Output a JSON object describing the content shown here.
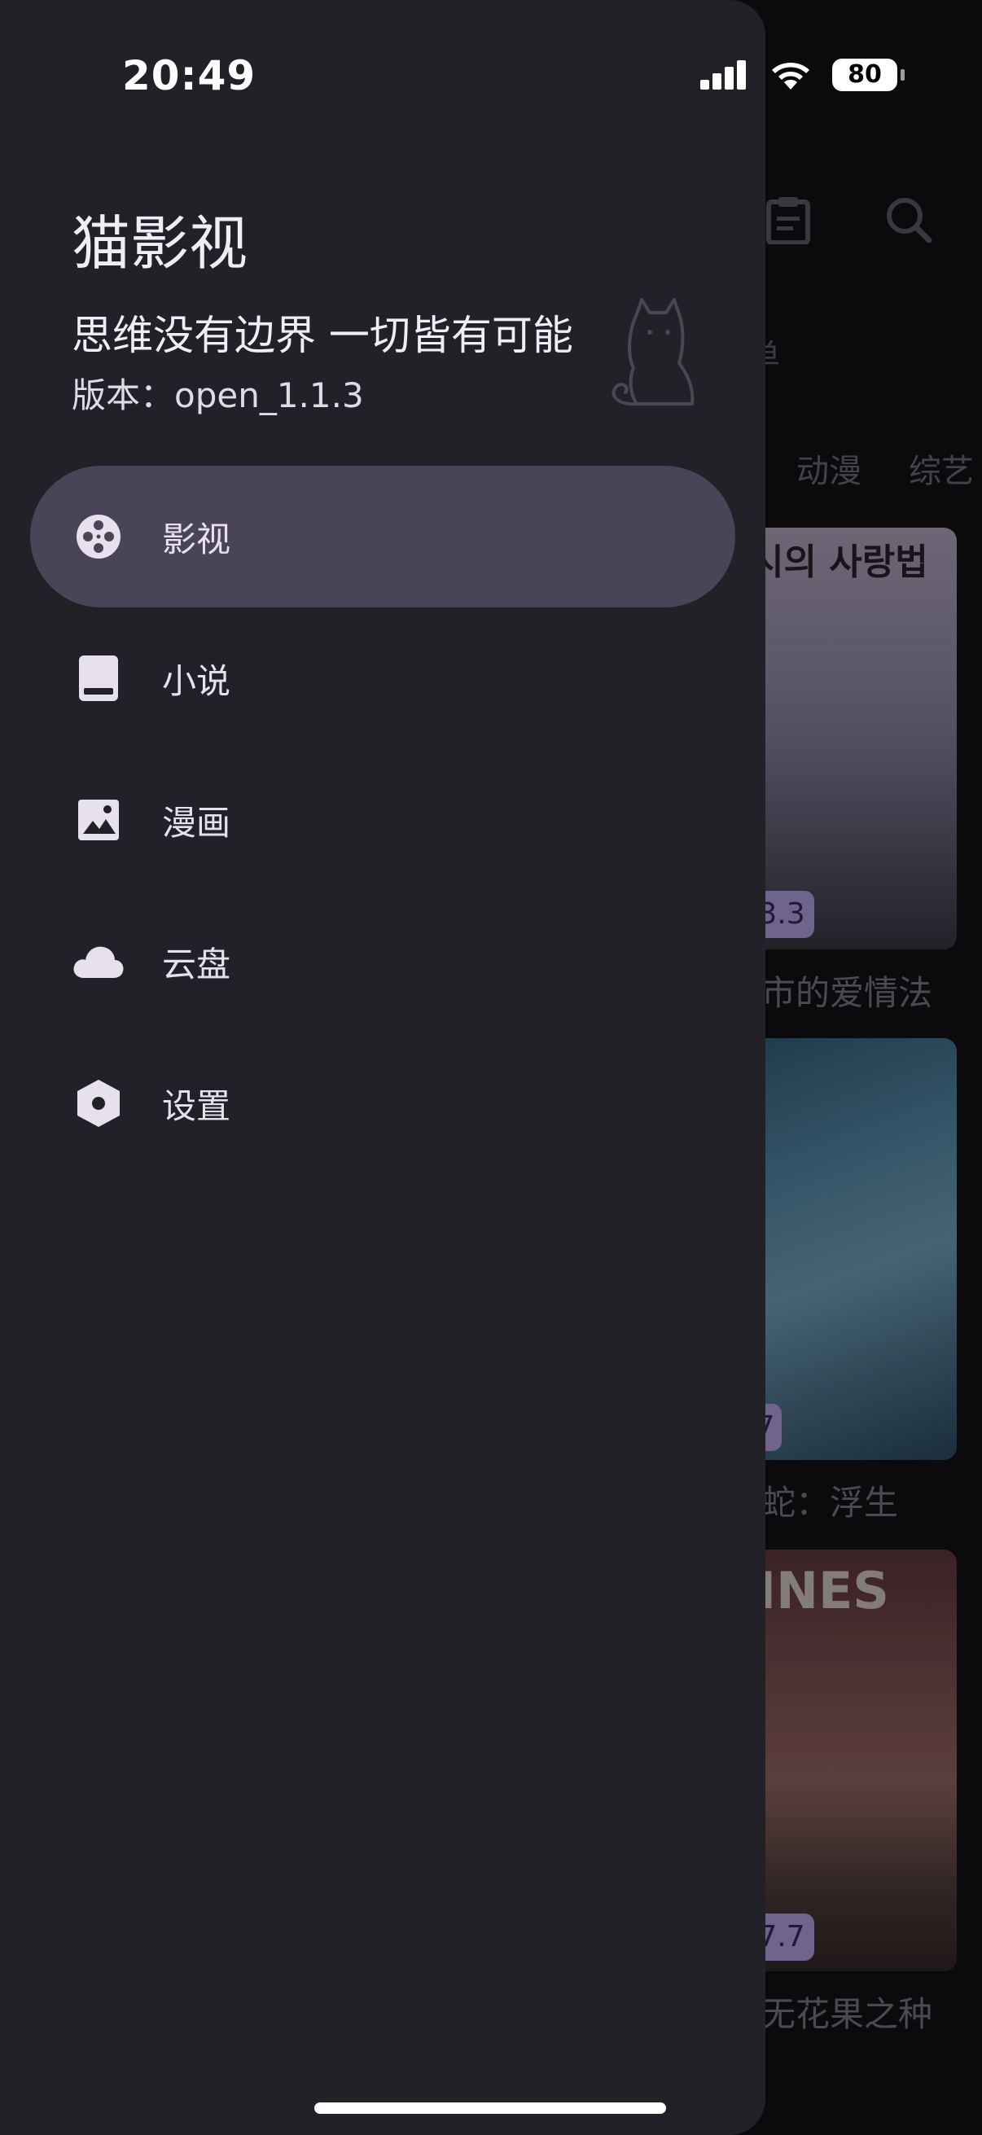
{
  "status_bar": {
    "time": "20:49",
    "battery": "80"
  },
  "drawer": {
    "app_name": "猫影视",
    "slogan": "思维没有边界 一切皆有可能",
    "version": "版本：open_1.1.3",
    "items": [
      {
        "label": "影视",
        "icon": "movie-reel-icon",
        "active": true
      },
      {
        "label": "小说",
        "icon": "book-icon",
        "active": false
      },
      {
        "label": "漫画",
        "icon": "image-icon",
        "active": false
      },
      {
        "label": "云盘",
        "icon": "cloud-icon",
        "active": false
      },
      {
        "label": "设置",
        "icon": "settings-hexagon-icon",
        "active": false
      }
    ]
  },
  "background": {
    "tab_partial": "单",
    "categories": [
      "动漫",
      "综艺"
    ],
    "posters": [
      {
        "text": "시의 사랑법",
        "rating": "3.3",
        "title": "市的爱情法"
      },
      {
        "text": "",
        "rating": "7",
        "title": "蛇：浮生"
      },
      {
        "text": "INES",
        "rating": "7.7",
        "title": "无花果之种"
      }
    ]
  },
  "colors": {
    "drawer_bg": "#222128",
    "active_item_bg": "#4a4458",
    "rating_bg": "#c9b7ff"
  }
}
